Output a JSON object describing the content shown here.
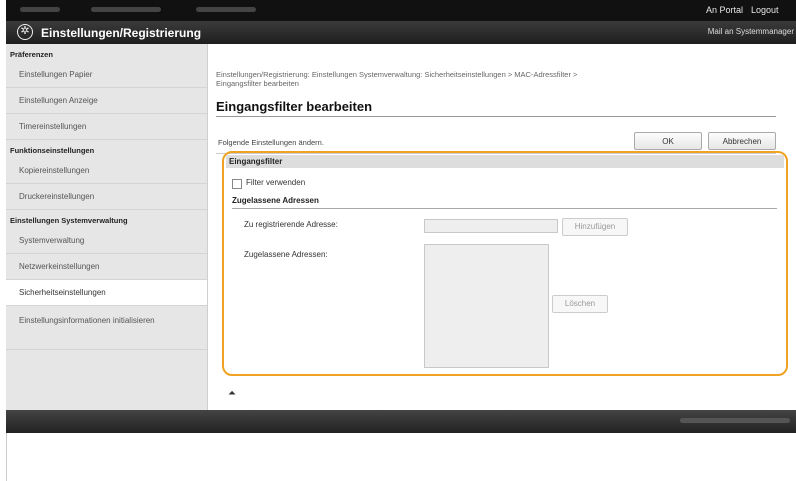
{
  "topbar": {
    "portal_label": "An Portal",
    "logout_label": "Logout"
  },
  "header": {
    "title": "Einstellungen/Registrierung",
    "mail_link": "Mail an Systemmanager"
  },
  "sidebar": {
    "sections": [
      {
        "title": "Präferenzen",
        "items": [
          "Einstellungen Papier",
          "Einstellungen Anzeige",
          "Timereinstellungen"
        ]
      },
      {
        "title": "Funktionseinstellungen",
        "items": [
          "Kopiereinstellungen",
          "Druckereinstellungen"
        ]
      },
      {
        "title": "Einstellungen Systemverwaltung",
        "items": [
          "Systemverwaltung",
          "Netzwerkeinstellungen",
          "Sicherheitseinstellungen",
          "Einstellungsinformationen initialisieren"
        ]
      }
    ],
    "active_item": "Sicherheitseinstellungen"
  },
  "main": {
    "breadcrumb_line1": "Einstellungen/Registrierung: Einstellungen Systemverwaltung: Sicherheitseinstellungen > MAC-Adressfilter >",
    "breadcrumb_line2": "Eingangsfilter bearbeiten",
    "page_title": "Eingangsfilter bearbeiten",
    "instruction": "Folgende Einstellungen ändern.",
    "ok_label": "OK",
    "cancel_label": "Abbrechen",
    "section_title": "Eingangsfilter",
    "checkbox_label": "Filter verwenden",
    "checkbox_checked": false,
    "subsection_title": "Zugelassene Adressen",
    "register_label": "Zu registrierende Adresse:",
    "register_value": "",
    "add_label": "Hinzufügen",
    "allowed_label": "Zugelassene Adressen:",
    "allowed_list": [],
    "delete_label": "Löschen",
    "totop_symbol": "⏶"
  },
  "colors": {
    "highlight": "#f0a322",
    "topbar": "#111111"
  }
}
